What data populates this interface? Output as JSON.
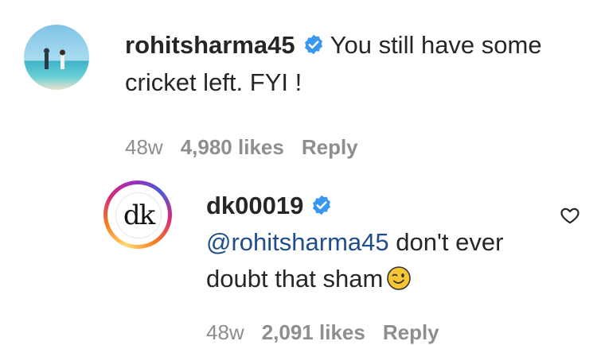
{
  "comments": [
    {
      "username": "rohitsharma45",
      "verified": true,
      "text": "You still have some cricket left. FYI !",
      "time": "48w",
      "likes": "4,980 likes",
      "reply_label": "Reply",
      "avatar": "beach-photo"
    },
    {
      "username": "dk00019",
      "verified": true,
      "mention": "@rohitsharma45",
      "text": "don't ever doubt that sham",
      "emoji": "winking-face",
      "time": "48w",
      "likes": "2,091 likes",
      "reply_label": "Reply",
      "avatar_logo_text": "dk",
      "has_story_ring": true
    }
  ],
  "icons": {
    "like": "heart-outline-icon",
    "verified": "verified-badge-icon"
  },
  "colors": {
    "verified_blue": "#3897f0",
    "muted_text": "#8e8e8e",
    "mention": "#1f4e8c"
  }
}
